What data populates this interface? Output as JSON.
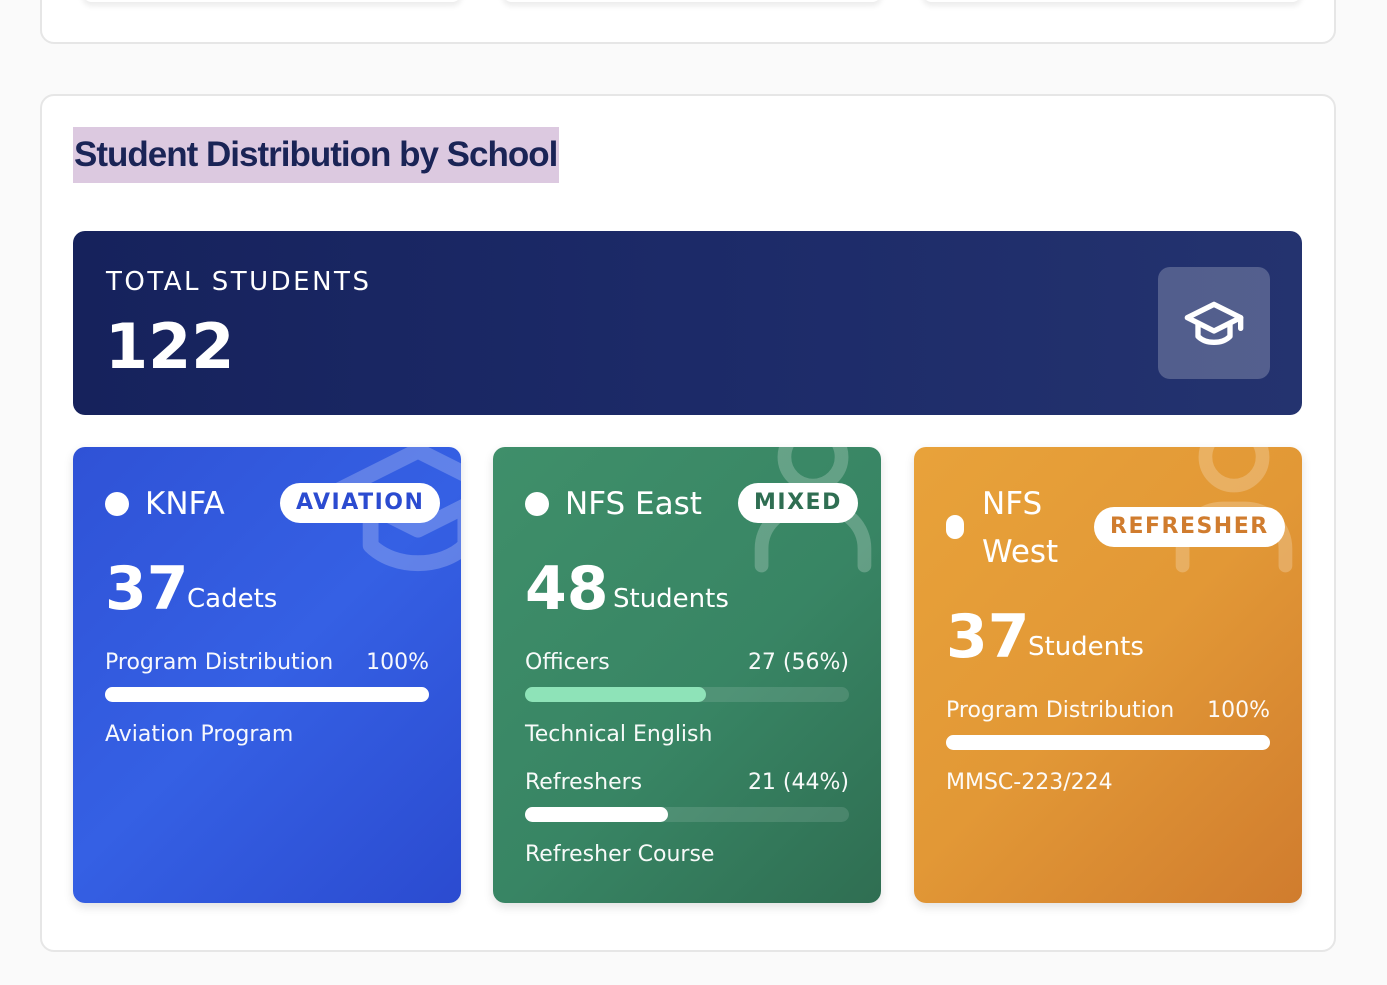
{
  "section": {
    "title": "Student Distribution by School"
  },
  "total": {
    "label": "TOTAL STUDENTS",
    "value": "122",
    "icon": "graduation-cap-icon"
  },
  "colors": {
    "title_highlight": "#dcc9e0",
    "title_text": "#1a2456",
    "total_bg": "#1c2a68",
    "knfa": "#2f52d6",
    "nfs_east": "#388564",
    "nfs_west": "#e29836",
    "mint_fill": "#8ee3b8"
  },
  "cards": [
    {
      "name": "KNFA",
      "badge": "AVIATION",
      "count": "37",
      "unit": "Cadets",
      "deco_icon": "graduation-cap-icon",
      "rows": [
        {
          "label": "Program Distribution",
          "value": "100%",
          "fill": 1.0,
          "desc": "Aviation Program"
        }
      ]
    },
    {
      "name": "NFS East",
      "badge": "MIXED",
      "count": "48",
      "unit": "Students",
      "deco_icon": "user-icon",
      "rows": [
        {
          "label": "Officers",
          "value": "27 (56%)",
          "fill": 0.56,
          "desc": "Technical English"
        },
        {
          "label": "Refreshers",
          "value": "21 (44%)",
          "fill": 0.44,
          "desc": "Refresher Course"
        }
      ]
    },
    {
      "name_line1": "NFS",
      "name_line2": "West",
      "badge": "REFRESHER",
      "count": "37",
      "unit": "Students",
      "deco_icon": "user-icon",
      "rows": [
        {
          "label": "Program Distribution",
          "value": "100%",
          "fill": 1.0,
          "desc": "MMSC-223/224"
        }
      ]
    }
  ]
}
